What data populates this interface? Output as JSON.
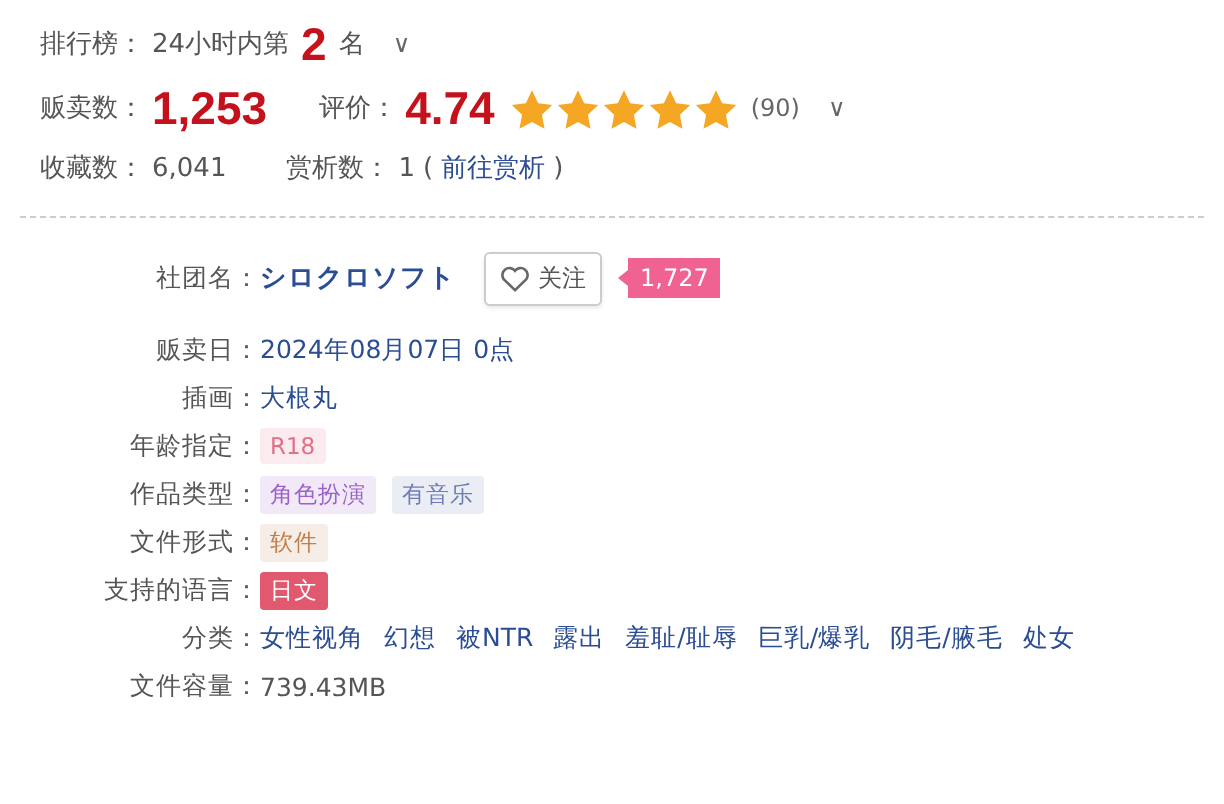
{
  "ranking": {
    "label": "排行榜：",
    "prefix": "24小时内第",
    "rank": "2",
    "suffix": "名",
    "toggle": "∨"
  },
  "sales": {
    "label": "贩卖数：",
    "value": "1,253"
  },
  "rating": {
    "label": "评价：",
    "value": "4.74",
    "stars": 5,
    "count": "(90)",
    "toggle": "∨"
  },
  "favorites": {
    "label": "收藏数：",
    "value": "6,041"
  },
  "reviews": {
    "label": "赏析数：",
    "value": "1",
    "link_open": "(",
    "link": "前往赏析",
    "link_close": ")"
  },
  "details": [
    {
      "kind": "circle",
      "label": "社团名：",
      "value": "シロクロソフト",
      "follow": "关注",
      "followers": "1,727"
    },
    {
      "kind": "link",
      "label": "贩卖日：",
      "value": "2024年08月07日 0点"
    },
    {
      "kind": "link",
      "label": "插画：",
      "value": "大根丸"
    },
    {
      "kind": "tags",
      "label": "年龄指定：",
      "tags": [
        {
          "text": "R18",
          "kind": "soft",
          "color": "#e0708a"
        }
      ]
    },
    {
      "kind": "tags",
      "label": "作品类型：",
      "tags": [
        {
          "text": "角色扮演",
          "kind": "soft",
          "color": "#9b62c9"
        },
        {
          "text": "有音乐",
          "kind": "soft",
          "color": "#6f7fb5"
        }
      ]
    },
    {
      "kind": "tags",
      "label": "文件形式：",
      "tags": [
        {
          "text": "软件",
          "kind": "soft",
          "color": "#c07f4a"
        }
      ]
    },
    {
      "kind": "tags",
      "label": "支持的语言：",
      "tags": [
        {
          "text": "日文",
          "kind": "solid",
          "color": "#e0596e"
        }
      ]
    },
    {
      "kind": "genres",
      "label": "分类：",
      "genres": [
        "女性视角",
        "幻想",
        "被NTR",
        "露出",
        "羞耻/耻辱",
        "巨乳/爆乳",
        "阴毛/腋毛",
        "处女"
      ]
    },
    {
      "kind": "text",
      "label": "文件容量：",
      "value": "739.43MB"
    }
  ]
}
